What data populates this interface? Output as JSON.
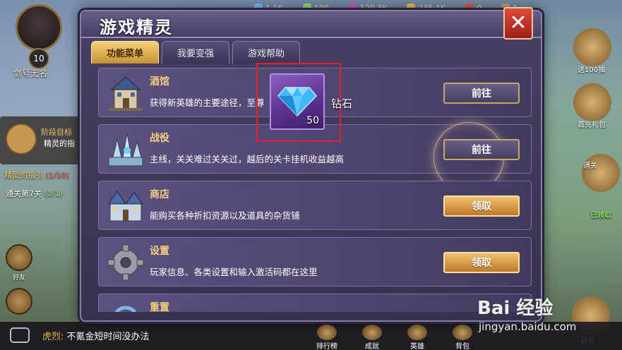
{
  "top_resources": [
    {
      "value": "1.1K",
      "color": "#6ac8ff",
      "icon": "gem-icon"
    },
    {
      "value": "100",
      "color": "#9be36a",
      "icon": "stamina-icon"
    },
    {
      "value": "120.3K",
      "color": "#d25ad6",
      "icon": "crystal-icon"
    },
    {
      "value": "235.1K",
      "color": "#f0c24a",
      "icon": "gold-icon"
    },
    {
      "value": "0",
      "color": "#e05a4a",
      "icon": "ruby-icon"
    },
    {
      "value": "0",
      "color": "#c9a060",
      "icon": "chest-icon"
    }
  ],
  "player": {
    "level": "10",
    "name": "剑号无名"
  },
  "quest": {
    "header": "阶段目标",
    "title": "精灵的指",
    "progress": "7/"
  },
  "guide": {
    "label": "精灵的指引",
    "value": "(1/10)"
  },
  "chapter": {
    "label": "通关第7关",
    "value": "(1/1)"
  },
  "left_buttons": [
    {
      "label": "好友"
    }
  ],
  "right_buttons": [
    {
      "label": "送100抽"
    },
    {
      "label": "首充礼包"
    },
    {
      "label": "通关"
    },
    {
      "label": "已领取"
    },
    {
      "label": "战役"
    }
  ],
  "chat": {
    "speaker": "虎烈:",
    "message": "不氪金短时间没办法"
  },
  "bottom_nav": [
    {
      "label": "排行榜"
    },
    {
      "label": "成就"
    },
    {
      "label": "英雄"
    },
    {
      "label": "背包"
    }
  ],
  "dialog": {
    "title": "游戏精灵",
    "close_label": "✕",
    "tabs": [
      {
        "label": "功能菜单",
        "active": true
      },
      {
        "label": "我要变强",
        "active": false
      },
      {
        "label": "游戏帮助",
        "active": false
      }
    ],
    "rows": [
      {
        "name": "酒馆",
        "desc": "获得新英雄的主要途径，至尊",
        "button": "前往",
        "icon": "tavern-icon"
      },
      {
        "name": "战役",
        "desc": "主线，关关难过关关过，越后的关卡挂机收益越高",
        "button": "前往",
        "icon": "campaign-icon"
      },
      {
        "name": "商店",
        "desc": "能购买各种折扣资源以及道具的杂货铺",
        "button": "领取",
        "icon": "shop-icon"
      },
      {
        "name": "设置",
        "desc": "玩家信息、各类设置和输入激活码都在这里",
        "button": "领取",
        "icon": "gear-icon"
      },
      {
        "name": "重置",
        "desc": "",
        "button": "",
        "icon": "reset-icon"
      }
    ]
  },
  "reward": {
    "count": "50",
    "name": "钻石",
    "icon": "diamond-icon"
  },
  "watermark": {
    "brand": "Bai 经验",
    "url": "jingyan.baidu.com"
  }
}
